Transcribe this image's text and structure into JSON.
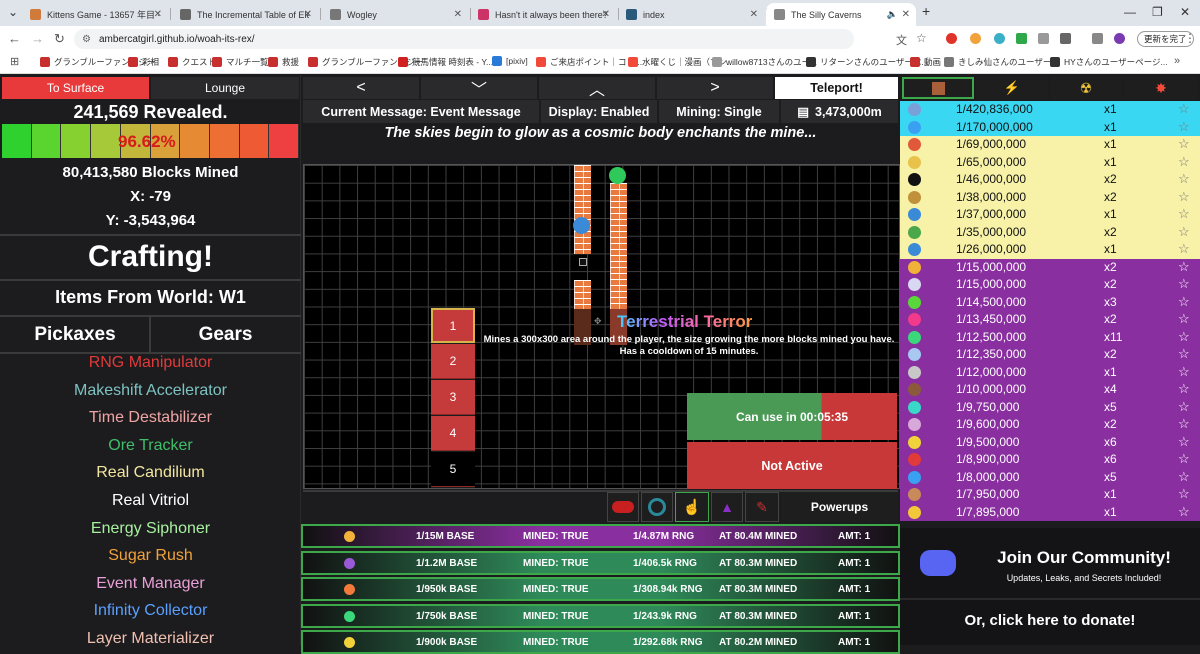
{
  "browser": {
    "tabs": [
      {
        "title": "Kittens Game - 13657 年目 - 夏",
        "favicon": "#d07a3c",
        "active": false
      },
      {
        "title": "The Incremental Table of Eleme",
        "favicon": "#666666",
        "active": false
      },
      {
        "title": "Wogley",
        "favicon": "#777777",
        "active": false
      },
      {
        "title": "Hasn't it always been there?",
        "favicon": "#cc3366",
        "active": false
      },
      {
        "title": "index",
        "favicon": "#2a5a7a",
        "active": false
      },
      {
        "title": "The Silly Caverns",
        "favicon": "#888888",
        "active": true
      }
    ],
    "url": "ambercatgirl.github.io/woah-its-rex/",
    "update_label": "更新を完了",
    "bookmarks": [
      "グランブルーファンタジー",
      "彩相",
      "クエスト",
      "マルチ一覧",
      "救援",
      "グランブルーファンタジー",
      "競馬情報 時刻表 - Y...",
      "[pixiv]",
      "ご来店ポイント｜コミ...",
      "水曜くじ｜漫画（マン...",
      "willow8713さんのユー...",
      "リターンさんのユーザーペ...",
      "動画",
      "きしみ仙さんのユーザー...",
      "HYさんのユーザーページ..."
    ]
  },
  "left": {
    "surface_label": "To Surface",
    "lounge_label": "Lounge",
    "revealed": "241,569 Revealed.",
    "percent": "96.62%",
    "progress": 0.9662,
    "bar_colors": [
      "#2fd12f",
      "#5ad42f",
      "#86d12f",
      "#a6c93a",
      "#c2b73a",
      "#d8a13a",
      "#e68a34",
      "#ee6f34",
      "#ee5a34",
      "#ee4040"
    ],
    "blocks_mined": "80,413,580 Blocks Mined",
    "x": "X: -79",
    "y": "Y: -3,543,964",
    "crafting": "Crafting!",
    "items_world": "Items From World: W1",
    "pickaxes_label": "Pickaxes",
    "gears_label": "Gears",
    "gears": [
      {
        "name": "RNG Manipulator",
        "color": "#e03a3a"
      },
      {
        "name": "Makeshift Accelerator",
        "color": "#7ec2c2"
      },
      {
        "name": "Time Destabilizer",
        "color": "#f0a5a5"
      },
      {
        "name": "Ore Tracker",
        "color": "#3fbf6a"
      },
      {
        "name": "Real Candilium",
        "color": "#f2e6a0"
      },
      {
        "name": "Real Vitriol",
        "color": "#ffffff"
      },
      {
        "name": "Energy Siphoner",
        "color": "#a8f0a0"
      },
      {
        "name": "Sugar Rush",
        "color": "#f2a23a"
      },
      {
        "name": "Event Manager",
        "color": "#e8a0d8"
      },
      {
        "name": "Infinity Collector",
        "color": "#5aa0ff"
      },
      {
        "name": "Layer Materializer",
        "color": "#f0c0b0"
      }
    ]
  },
  "mid": {
    "teleport_label": "Teleport!",
    "current_message": "Current Message: Event Message",
    "display": "Display: Enabled",
    "mining": "Mining: Single",
    "depth": "3,473,000m",
    "message": "The skies begin to glow as a cosmic body enchants the mine...",
    "slots": [
      "1",
      "2",
      "3",
      "4",
      "5"
    ],
    "ability_name": "Terrestrial Terror",
    "ability_desc": "Mines a 300x300 area around the player, the size growing the more blocks mined you have. Has a cooldown of 15 minutes.",
    "cooldown": "Can use in 00:05:35",
    "cooldown_progress": 0.64,
    "status": "Not Active",
    "powerups_label": "Powerups",
    "rows": [
      {
        "icon": "#f2b23a",
        "base": "1/15M BASE",
        "mined": "MINED: TRUE",
        "rng": "1/4.87M RNG",
        "at": "AT 80.4M MINED",
        "amt": "AMT: 1",
        "bg": "#8a2fa0"
      },
      {
        "icon": "#9a5ad8",
        "base": "1/1.2M BASE",
        "mined": "MINED: TRUE",
        "rng": "1/406.5k RNG",
        "at": "AT 80.3M MINED",
        "amt": "AMT: 1",
        "bg": "#2f8a5a"
      },
      {
        "icon": "#f27a3a",
        "base": "1/950k BASE",
        "mined": "MINED: TRUE",
        "rng": "1/308.94k RNG",
        "at": "AT 80.3M MINED",
        "amt": "AMT: 1",
        "bg": "#2f8a5a"
      },
      {
        "icon": "#3ad87a",
        "base": "1/750k BASE",
        "mined": "MINED: TRUE",
        "rng": "1/243.9k RNG",
        "at": "AT 80.3M MINED",
        "amt": "AMT: 1",
        "bg": "#2f8a5a"
      },
      {
        "icon": "#f2d23a",
        "base": "1/900k BASE",
        "mined": "MINED: TRUE",
        "rng": "1/292.68k RNG",
        "at": "AT 80.2M MINED",
        "amt": "AMT: 1",
        "bg": "#2f8a5a"
      }
    ]
  },
  "right": {
    "ores": [
      {
        "rarity": "1/420,836,000",
        "amt": "x1",
        "bg": "#3ad7f2",
        "icon": "#7aa0d8"
      },
      {
        "rarity": "1/170,000,000",
        "amt": "x1",
        "bg": "#3ad7f2",
        "icon": "#3aa0f2"
      },
      {
        "rarity": "1/69,000,000",
        "amt": "x1",
        "bg": "#f7f2a8",
        "icon": "#e05a3a"
      },
      {
        "rarity": "1/65,000,000",
        "amt": "x1",
        "bg": "#f7f2a8",
        "icon": "#e8c24a"
      },
      {
        "rarity": "1/46,000,000",
        "amt": "x2",
        "bg": "#f7f2a8",
        "icon": "#111111"
      },
      {
        "rarity": "1/38,000,000",
        "amt": "x2",
        "bg": "#f7f2a8",
        "icon": "#c0903a"
      },
      {
        "rarity": "1/37,000,000",
        "amt": "x1",
        "bg": "#f7f2a8",
        "icon": "#3a8ad8"
      },
      {
        "rarity": "1/35,000,000",
        "amt": "x2",
        "bg": "#f7f2a8",
        "icon": "#4aa84a"
      },
      {
        "rarity": "1/26,000,000",
        "amt": "x1",
        "bg": "#f7f2a8",
        "icon": "#3a8ad8"
      },
      {
        "rarity": "1/15,000,000",
        "amt": "x2",
        "bg": "#8a2fa0",
        "icon": "#f2b23a"
      },
      {
        "rarity": "1/15,000,000",
        "amt": "x2",
        "bg": "#8a2fa0",
        "icon": "#d8d8f2"
      },
      {
        "rarity": "1/14,500,000",
        "amt": "x3",
        "bg": "#8a2fa0",
        "icon": "#5ad83a"
      },
      {
        "rarity": "1/13,450,000",
        "amt": "x2",
        "bg": "#8a2fa0",
        "icon": "#f23a8a"
      },
      {
        "rarity": "1/12,500,000",
        "amt": "x11",
        "bg": "#8a2fa0",
        "icon": "#3ad87a"
      },
      {
        "rarity": "1/12,350,000",
        "amt": "x2",
        "bg": "#8a2fa0",
        "icon": "#a8c8f2"
      },
      {
        "rarity": "1/12,000,000",
        "amt": "x1",
        "bg": "#8a2fa0",
        "icon": "#c8c8c8"
      },
      {
        "rarity": "1/10,000,000",
        "amt": "x4",
        "bg": "#8a2fa0",
        "icon": "#8a5a3a"
      },
      {
        "rarity": "1/9,750,000",
        "amt": "x5",
        "bg": "#8a2fa0",
        "icon": "#3ad8c8"
      },
      {
        "rarity": "1/9,600,000",
        "amt": "x2",
        "bg": "#8a2fa0",
        "icon": "#d8a8d8"
      },
      {
        "rarity": "1/9,500,000",
        "amt": "x6",
        "bg": "#8a2fa0",
        "icon": "#f2d23a"
      },
      {
        "rarity": "1/8,900,000",
        "amt": "x6",
        "bg": "#8a2fa0",
        "icon": "#e03a3a"
      },
      {
        "rarity": "1/8,000,000",
        "amt": "x5",
        "bg": "#8a2fa0",
        "icon": "#3aa0f2"
      },
      {
        "rarity": "1/7,950,000",
        "amt": "x1",
        "bg": "#8a2fa0",
        "icon": "#c88a5a"
      },
      {
        "rarity": "1/7,895,000",
        "amt": "x1",
        "bg": "#8a2fa0",
        "icon": "#f2c83a"
      }
    ],
    "community_title": "Join Our Community!",
    "community_sub": "Updates, Leaks, and Secrets Included!",
    "donate": "Or, click here to donate!"
  }
}
